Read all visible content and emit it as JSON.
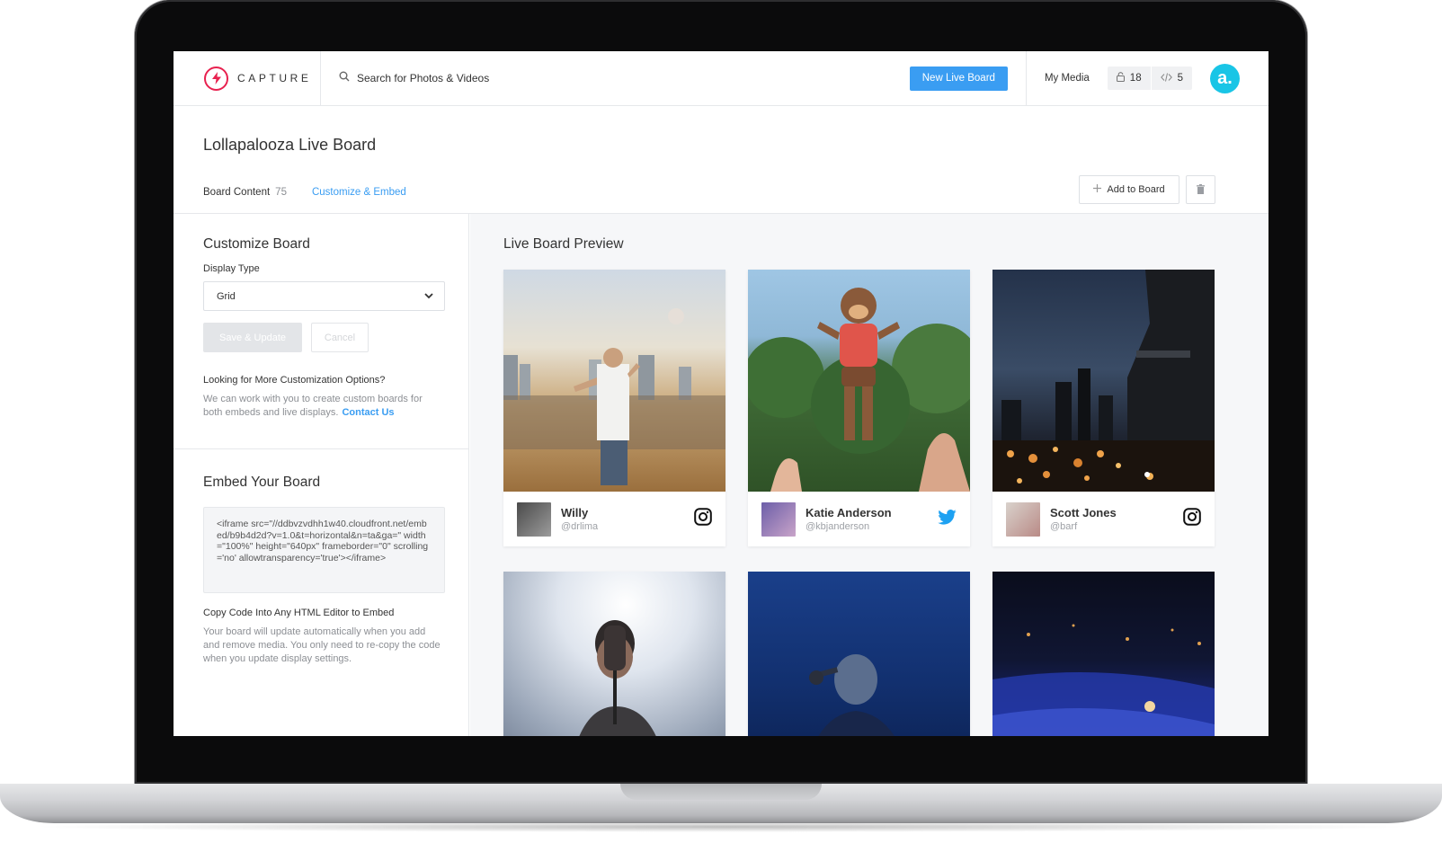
{
  "header": {
    "brand": "CAPTURE",
    "search_placeholder": "Search for Photos & Videos",
    "new_board_label": "New Live Board",
    "my_media_label": "My Media",
    "locked_count": "18",
    "embed_count": "5",
    "avatar_letter": "a."
  },
  "page": {
    "title": "Lollapalooza Live Board",
    "tabs": [
      {
        "label": "Board Content",
        "count": "75"
      },
      {
        "label": "Customize & Embed"
      }
    ],
    "add_to_board_label": "Add to Board"
  },
  "customize": {
    "title": "Customize Board",
    "display_type_label": "Display Type",
    "display_type_value": "Grid",
    "save_label": "Save & Update",
    "cancel_label": "Cancel",
    "more_title": "Looking for More Customization Options?",
    "more_text": "We can work with you to create custom boards for both embeds and live displays.",
    "contact_label": "Contact Us"
  },
  "embed": {
    "title": "Embed Your Board",
    "code": "<iframe src=\"//ddbvzvdhh1w40.cloudfront.net/embed/b9b4d2d?v=1.0&t=horizontal&n=ta&ga=\" width=\"100%\" height=\"640px\" frameborder=\"0\" scrolling='no' allowtransparency='true'></iframe>",
    "copy_title": "Copy Code Into Any HTML Editor to Embed",
    "copy_text": "Your board will update automatically when you add and remove media. You only need to re-copy the code when you update display settings."
  },
  "preview": {
    "title": "Live Board Preview",
    "cards": [
      {
        "name": "Willy",
        "handle": "@drlima",
        "network": "instagram-icon"
      },
      {
        "name": "Katie Anderson",
        "handle": "@kbjanderson",
        "network": "twitter-icon"
      },
      {
        "name": "Scott Jones",
        "handle": "@barf",
        "network": "instagram-icon"
      }
    ]
  },
  "colors": {
    "accent": "#3a9df2",
    "brand": "#e8214f",
    "avatar": "#19c5e6",
    "twitter": "#1da1f2"
  }
}
